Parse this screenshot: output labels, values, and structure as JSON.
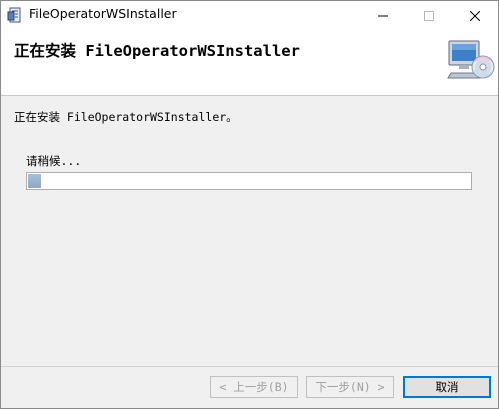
{
  "window": {
    "title": "FileOperatorWSInstaller",
    "controls": {
      "minimize_icon": "minimize-icon",
      "maximize_icon": "maximize-icon",
      "close_icon": "close-icon"
    }
  },
  "header": {
    "title": "正在安装 FileOperatorWSInstaller",
    "graphic_icon": "computer-with-disc-icon"
  },
  "body": {
    "status_text": "正在安装 FileOperatorWSInstaller。",
    "wait_text": "请稍候...",
    "progress_fraction": 0.03
  },
  "footer": {
    "back_label": "< 上一步(B)",
    "next_label": "下一步(N) >",
    "cancel_label": "取消"
  },
  "colors": {
    "progress_fill": "#a6bed8",
    "focus_border": "#0078d7",
    "disabled_text": "#a0a0a0"
  }
}
